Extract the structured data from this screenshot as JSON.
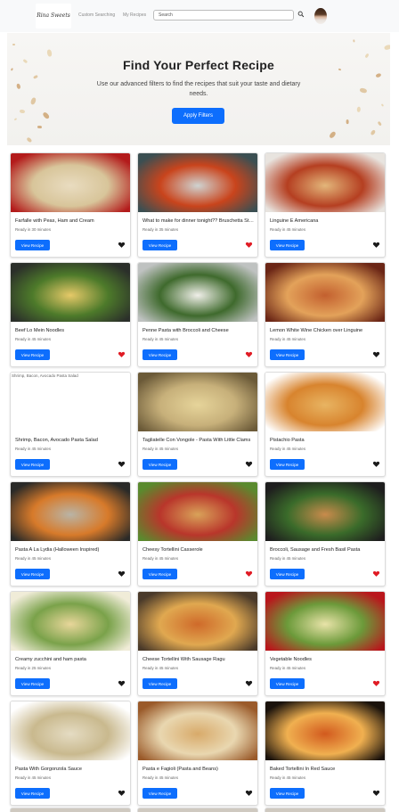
{
  "navbar": {
    "logo_text": "Rina Sweets",
    "links": [
      "Custom Searching",
      "My Recipes"
    ],
    "search_placeholder": "Search",
    "search_icon": "search-icon",
    "avatar_icon": "avatar"
  },
  "hero": {
    "title": "Find Your Perfect Recipe",
    "subtitle": "Use our advanced filters to find the recipes that suit your taste and dietary needs.",
    "button_label": "Apply Filters"
  },
  "colors": {
    "primary": "#0d6efd",
    "heart_liked": "#e01b24",
    "heart_default": "#1a1a1a"
  },
  "recipe_button_label": "View Recipe",
  "recipes": [
    {
      "title": "Farfalle with Peas, Ham and Cream",
      "ready": "Ready in 30 minutes",
      "liked": false,
      "img": [
        "#b31b1b",
        "#e9dcc0",
        "#d8c59a"
      ]
    },
    {
      "title": "What to make for dinner tonight?? Bruschetta Style Pork & Pasta",
      "ready": "Ready in 35 minutes",
      "liked": true,
      "img": [
        "#3b4f52",
        "#cfd3d1",
        "#c9441c"
      ]
    },
    {
      "title": "Linguine E Americana",
      "ready": "Ready in 45 minutes",
      "liked": false,
      "img": [
        "#e8e4df",
        "#e3b67a",
        "#b53f21"
      ]
    },
    {
      "title": "Beef Lo Mein Noodles",
      "ready": "Ready in 45 minutes",
      "liked": true,
      "img": [
        "#2b2f2a",
        "#e6c968",
        "#4d7a2a"
      ]
    },
    {
      "title": "Penne Pasta with Broccoli and Cheese",
      "ready": "Ready in 45 minutes",
      "liked": true,
      "img": [
        "#bfc2c1",
        "#f0efe9",
        "#3f6a2d"
      ]
    },
    {
      "title": "Lemon White Wine Chicken over Linguine",
      "ready": "Ready in 45 minutes",
      "liked": false,
      "img": [
        "#6b2616",
        "#c3602f",
        "#e3a25a"
      ]
    },
    {
      "title": "Shrimp, Bacon, Avocado Pasta Salad",
      "ready": "Ready in 45 minutes",
      "liked": false,
      "alt": "Shrimp, Bacon, Avocado Pasta Salad",
      "img": [
        "#ffffff",
        "#ffffff",
        "#ffffff"
      ]
    },
    {
      "title": "Tagliatelle Con Vongole - Pasta With Little Clams",
      "ready": "Ready in 45 minutes",
      "liked": false,
      "img": [
        "#6b5a38",
        "#e6d49a",
        "#c7b07a"
      ]
    },
    {
      "title": "Pistachio Pasta",
      "ready": "Ready in 45 minutes",
      "liked": false,
      "img": [
        "#ffffff",
        "#e8b462",
        "#d8842e"
      ]
    },
    {
      "title": "Pasta A La Lydia (Halloween Inspired)",
      "ready": "Ready in 45 minutes",
      "liked": false,
      "img": [
        "#2a2a28",
        "#b9b4a6",
        "#d77a2a"
      ]
    },
    {
      "title": "Cheesy Tortellini Casserole",
      "ready": "Ready in 45 minutes",
      "liked": true,
      "img": [
        "#5a8a2e",
        "#d9a259",
        "#b9362b"
      ]
    },
    {
      "title": "Broccoli, Sausage and Fresh Basil Pasta",
      "ready": "Ready in 45 minutes",
      "liked": true,
      "img": [
        "#1e1e1e",
        "#c98b4c",
        "#3a6b2a"
      ]
    },
    {
      "title": "Creamy zucchini and ham pasta",
      "ready": "Ready in 25 minutes",
      "liked": false,
      "img": [
        "#f0ecd8",
        "#e8d69a",
        "#7aa24a"
      ]
    },
    {
      "title": "Cheese Tortellini With Sausage Ragu",
      "ready": "Ready in 45 minutes",
      "liked": false,
      "img": [
        "#4a3a2a",
        "#cf6a2a",
        "#e0a850"
      ]
    },
    {
      "title": "Vegetable Noodles",
      "ready": "Ready in 45 minutes",
      "liked": true,
      "img": [
        "#b9161c",
        "#e8e3a8",
        "#6c9a3a"
      ]
    },
    {
      "title": "Pasta With Gorgonzola Sauce",
      "ready": "Ready in 45 minutes",
      "liked": false,
      "img": [
        "#ffffff",
        "#e5dcc3",
        "#c9b98e"
      ]
    },
    {
      "title": "Pasta e Fagioli (Pasta and Beans)",
      "ready": "Ready in 45 minutes",
      "liked": false,
      "img": [
        "#9a5a2a",
        "#d8aa6a",
        "#e9d7b0"
      ]
    },
    {
      "title": "Baked Tortellini In Red Sauce",
      "ready": "Ready in 45 minutes",
      "liked": false,
      "img": [
        "#1a120c",
        "#d25a1e",
        "#f0b050"
      ]
    }
  ]
}
